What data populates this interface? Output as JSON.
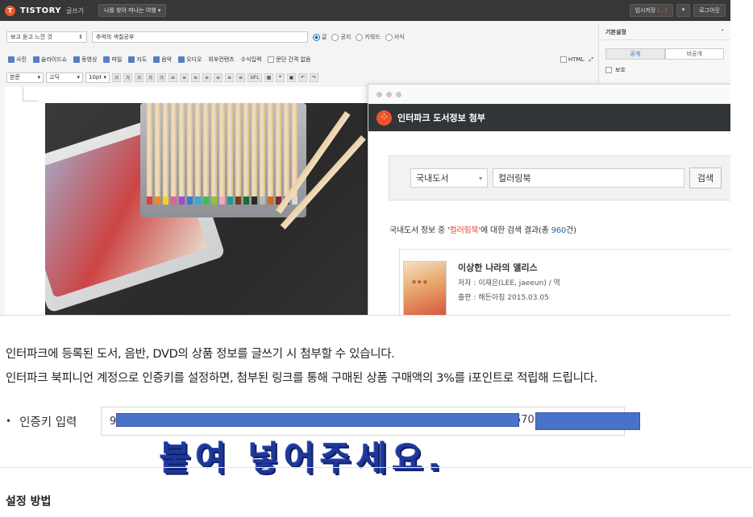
{
  "editor": {
    "topbar": {
      "logo": "TISTORY",
      "section": "글쓰기",
      "blog_select": "나를 찾아 떠나는 여행",
      "draft_label": "임시저장",
      "draft_count": "(...)",
      "logout": "로그아웃"
    },
    "post": {
      "category": "보고 듣고 느낀 것",
      "title": "추억의 색칠공부",
      "visibility_options": [
        "글",
        "공지",
        "키워드",
        "서식"
      ],
      "visibility_selected": "글"
    },
    "attach_toolbar": {
      "items": [
        "사진",
        "슬라이드쇼",
        "동영상",
        "파일",
        "지도",
        "음악",
        "오디오",
        "외부컨텐츠",
        "수식입력"
      ],
      "spacing_label": "문단 간격 없음",
      "html_label": "HTML"
    },
    "format_toolbar": {
      "style": "본문",
      "font": "고딕",
      "size": "10pt",
      "buttons": [
        "가",
        "가",
        "가",
        "가",
        "가",
        "≡",
        "≡",
        "≡",
        "≡",
        "≡",
        "≡",
        "≡",
        "UFL"
      ]
    },
    "sidebar": {
      "title": "기본설정",
      "tabs": [
        "공개",
        "비공개"
      ],
      "active_tab": "공개",
      "protect_label": "보호"
    }
  },
  "modal": {
    "title": "인터파크 도서정보 첨부",
    "search": {
      "category": "국내도서",
      "query": "컬러링북",
      "button": "검색"
    },
    "result": {
      "prefix": "국내도서 정보 중 '",
      "keyword": "컬러링북",
      "middle": "'에 대한 검색 결과(총 ",
      "count": "960",
      "suffix": "건)"
    },
    "book": {
      "title": "이상한 나라의 앨리스",
      "author": "저자 : 이재은(LEE, jaeeun) / 역",
      "publisher": "출판 : 해든아침 2015.03.05"
    }
  },
  "description": {
    "line1": "인터파크에 등록된 도서, 음반, DVD의 상품 정보를 글쓰기 시 첨부할 수 있습니다.",
    "line2": "인터파크 북피니언 계정으로 인증키를 설정하면, 첨부된 링크를 통해 구매된 상품 구매액의 3%를 i포인트로 적립해 드립니다."
  },
  "auth_key": {
    "bullet": "•",
    "label": "인증키 입력",
    "value_start": "9",
    "value_visible_tail": "570",
    "overlay_text": "붙여 넣어주세요."
  },
  "setup": {
    "title": "설정 방법"
  }
}
